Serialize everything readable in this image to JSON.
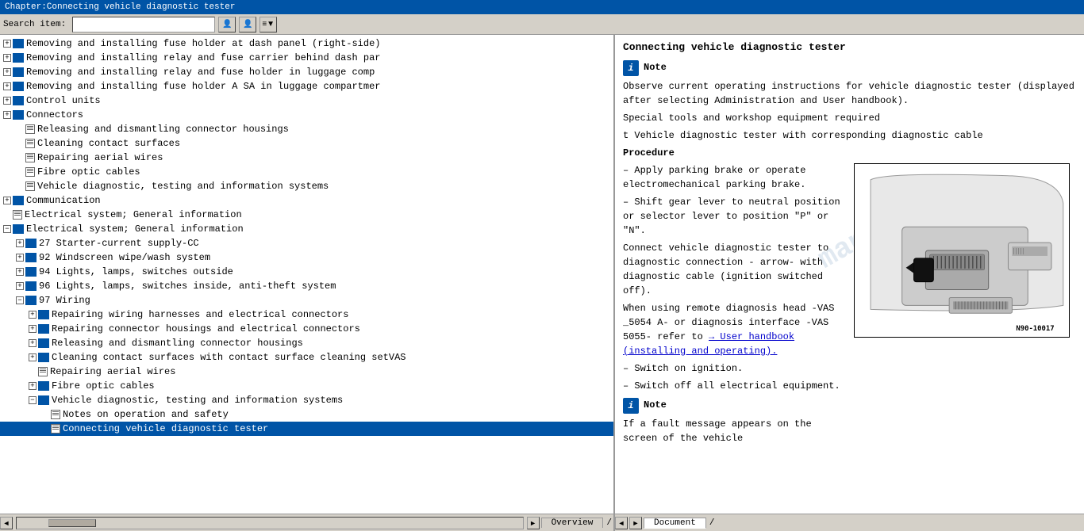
{
  "titleBar": {
    "text": "Chapter:Connecting vehicle diagnostic tester"
  },
  "toolbar": {
    "searchLabel": "Search item:",
    "searchPlaceholder": "",
    "btn1": "👤",
    "btn2": "👤",
    "btn3": "≡"
  },
  "leftPanel": {
    "items": [
      {
        "id": "item1",
        "indent": "indent1",
        "type": "expand",
        "icon": "folder",
        "text": "Removing and installing fuse holder at dash panel (right-side)"
      },
      {
        "id": "item2",
        "indent": "indent1",
        "type": "expand",
        "icon": "folder",
        "text": "Removing and installing relay and fuse carrier behind dash par"
      },
      {
        "id": "item3",
        "indent": "indent1",
        "type": "expand",
        "icon": "folder",
        "text": "Removing and installing relay and fuse holder in luggage comp"
      },
      {
        "id": "item4",
        "indent": "indent1",
        "type": "expand",
        "icon": "folder",
        "text": "Removing and installing fuse holder A SA in luggage compartmer"
      },
      {
        "id": "item5",
        "indent": "indent1",
        "type": "expand",
        "icon": "folder",
        "text": "Control units"
      },
      {
        "id": "item6",
        "indent": "indent1",
        "type": "expand",
        "icon": "folder",
        "text": "Connectors"
      },
      {
        "id": "item7",
        "indent": "indent2",
        "type": "none",
        "icon": "page",
        "text": "Releasing and dismantling connector housings"
      },
      {
        "id": "item8",
        "indent": "indent2",
        "type": "none",
        "icon": "page",
        "text": "Cleaning contact surfaces"
      },
      {
        "id": "item9",
        "indent": "indent2",
        "type": "none",
        "icon": "page",
        "text": "Repairing aerial wires"
      },
      {
        "id": "item10",
        "indent": "indent2",
        "type": "none",
        "icon": "page",
        "text": "Fibre optic cables"
      },
      {
        "id": "item11",
        "indent": "indent2",
        "type": "none",
        "icon": "page",
        "text": "Vehicle diagnostic, testing and information systems"
      },
      {
        "id": "item12",
        "indent": "indent1",
        "type": "expand",
        "icon": "folder",
        "text": "Communication"
      },
      {
        "id": "item13",
        "indent": "indent1",
        "type": "none",
        "icon": "page",
        "text": "Electrical system; General information"
      },
      {
        "id": "item14",
        "indent": "indent1",
        "type": "expand-open",
        "icon": "folder",
        "text": "Electrical system; General information"
      },
      {
        "id": "item15",
        "indent": "indent2",
        "type": "expand",
        "icon": "folder",
        "text": "27 Starter-current supply-CC"
      },
      {
        "id": "item16",
        "indent": "indent2",
        "type": "expand",
        "icon": "folder",
        "text": "92 Windscreen wipe/wash system"
      },
      {
        "id": "item17",
        "indent": "indent2",
        "type": "expand",
        "icon": "folder",
        "text": "94 Lights, lamps, switches outside"
      },
      {
        "id": "item18",
        "indent": "indent2",
        "type": "expand",
        "icon": "folder",
        "text": "96 Lights, lamps, switches inside, anti-theft system"
      },
      {
        "id": "item19",
        "indent": "indent2",
        "type": "expand-open",
        "icon": "folder",
        "text": "97 Wiring"
      },
      {
        "id": "item20",
        "indent": "indent3",
        "type": "expand",
        "icon": "folder",
        "text": "Repairing wiring harnesses and electrical connectors"
      },
      {
        "id": "item21",
        "indent": "indent3",
        "type": "expand",
        "icon": "folder",
        "text": "Repairing connector housings and electrical connectors"
      },
      {
        "id": "item22",
        "indent": "indent3",
        "type": "expand",
        "icon": "folder",
        "text": "Releasing and dismantling connector housings"
      },
      {
        "id": "item23",
        "indent": "indent3",
        "type": "expand",
        "icon": "folder",
        "text": "Cleaning contact surfaces with contact surface cleaning setVAS"
      },
      {
        "id": "item24",
        "indent": "indent3",
        "type": "none",
        "icon": "page",
        "text": "Repairing aerial wires"
      },
      {
        "id": "item25",
        "indent": "indent3",
        "type": "expand",
        "icon": "folder",
        "text": "Fibre optic cables"
      },
      {
        "id": "item26",
        "indent": "indent3",
        "type": "expand-open",
        "icon": "folder",
        "text": "Vehicle diagnostic, testing and information systems"
      },
      {
        "id": "item27",
        "indent": "indent4",
        "type": "none",
        "icon": "page",
        "text": "Notes on operation and safety"
      },
      {
        "id": "item28",
        "indent": "indent4",
        "type": "none",
        "icon": "page",
        "text": "Connecting vehicle diagnostic tester",
        "selected": true
      }
    ]
  },
  "rightPanel": {
    "title": "Connecting vehicle diagnostic tester",
    "noteLabel": "Note",
    "noteText": "Observe current operating instructions for vehicle diagnostic tester (displayed after selecting Administration and User handbook).",
    "specialToolsLabel": "Special tools and workshop equipment required",
    "toolItem": "t  Vehicle diagnostic tester with corresponding diagnostic cable",
    "procedureLabel": "Procedure",
    "steps": [
      "Apply parking brake or operate electromechanical parking brake.",
      "Shift gear lever to neutral position or selector lever to position \"P\" or \"N\"."
    ],
    "connectText": "Connect vehicle diagnostic tester to diagnostic connection - arrow- with diagnostic cable (ignition switched off).",
    "remoteText": "When using remote diagnosis head -VAS _5054 A- or diagnosis interface -VAS 5055- refer to",
    "linkText": "→ User handbook (installing and operating).",
    "switchOnText": "Switch on ignition.",
    "switchOffText": "Switch off all electrical equipment.",
    "noteLabel2": "Note",
    "noteText2": "If a fault message appears on the screen of the vehicle",
    "diagramLabel": "N90-10017",
    "arrowText": "arrow - With diagnostic"
  },
  "statusBar": {
    "leftTabs": [
      {
        "label": "▼",
        "type": "arrow"
      },
      {
        "label": "Overview",
        "active": false
      },
      {
        "label": "/",
        "type": "sep"
      }
    ],
    "rightTabs": [
      {
        "label": "◀",
        "type": "arrow"
      },
      {
        "label": "▶",
        "type": "arrow"
      },
      {
        "label": "Document",
        "active": true
      },
      {
        "label": "/",
        "type": "sep"
      }
    ]
  }
}
